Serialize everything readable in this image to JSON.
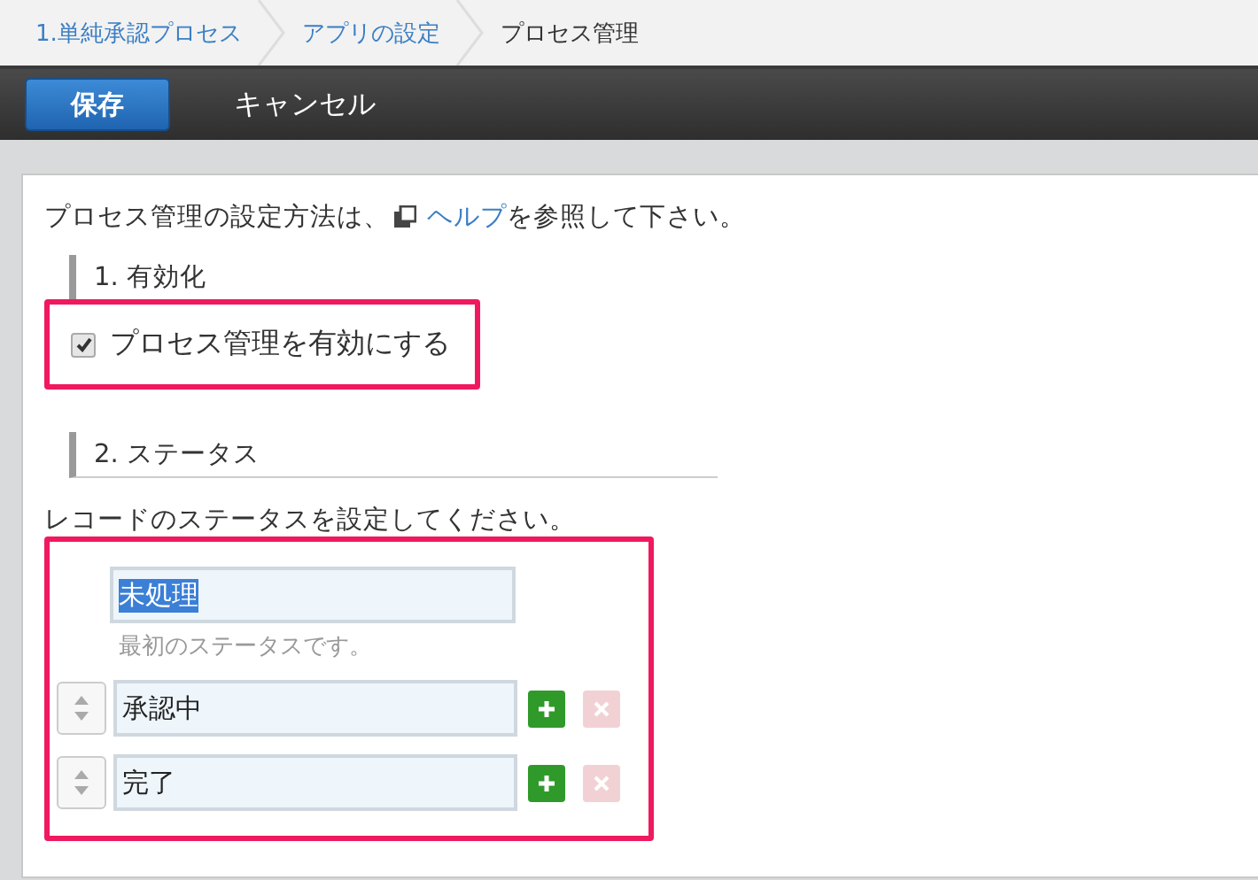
{
  "breadcrumb": [
    {
      "label": "1.単純承認プロセス",
      "link": true
    },
    {
      "label": "アプリの設定",
      "link": true
    },
    {
      "label": "プロセス管理",
      "link": false
    }
  ],
  "toolbar": {
    "save": "保存",
    "cancel": "キャンセル"
  },
  "intro": {
    "before": "プロセス管理の設定方法は、",
    "link": "ヘルプ",
    "after": "を参照して下さい。"
  },
  "section1": {
    "title": "1. 有効化",
    "checkbox": {
      "label": "プロセス管理を有効にする",
      "checked": true
    }
  },
  "section2": {
    "title": "2. ステータス",
    "description": "レコードのステータスを設定してください。",
    "statuses": [
      {
        "kind": "initial",
        "value": "未処理",
        "text_selected": true,
        "note": "最初のステータスです。"
      },
      {
        "kind": "normal",
        "value": "承認中",
        "text_selected": false,
        "remove_disabled": true
      },
      {
        "kind": "normal",
        "value": "完了",
        "text_selected": false,
        "remove_disabled": true
      }
    ]
  }
}
